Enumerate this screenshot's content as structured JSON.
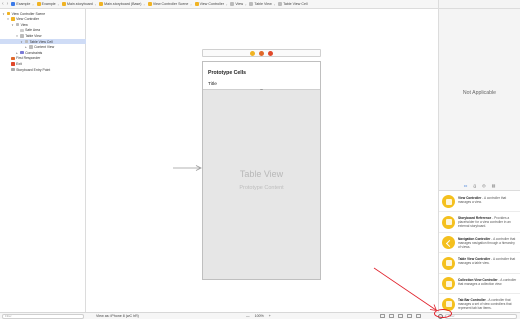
{
  "jumpbar": {
    "crumbs": [
      {
        "label": "Example",
        "color": "#3b7ae8"
      },
      {
        "label": "Example",
        "color": "#f0b323"
      },
      {
        "label": "Main.storyboard",
        "color": "#f0b323"
      },
      {
        "label": "Main.storyboard (Base)",
        "color": "#f0b323"
      },
      {
        "label": "View Controller Scene",
        "color": "#f0b323"
      },
      {
        "label": "View Controller",
        "color": "#f0b323"
      },
      {
        "label": "View",
        "color": "#bbbbbb"
      },
      {
        "label": "Table View",
        "color": "#bbbbbb"
      },
      {
        "label": "Table View Cell",
        "color": "#bbbbbb"
      }
    ]
  },
  "outline": {
    "rows": [
      {
        "label": "View Controller Scene",
        "indent": 0,
        "tri": "▾",
        "color": "#f0b323"
      },
      {
        "label": "View Controller",
        "indent": 1,
        "tri": "▾",
        "color": "#f0b323"
      },
      {
        "label": "View",
        "indent": 2,
        "tri": "▾",
        "color": "#bbbbbb"
      },
      {
        "label": "Safe Area",
        "indent": 3,
        "tri": "",
        "color": "#cccccc"
      },
      {
        "label": "Table View",
        "indent": 3,
        "tri": "▾",
        "color": "#bbbbbb"
      },
      {
        "label": "Table View Cell",
        "indent": 4,
        "tri": "▾",
        "color": "#bbbbbb",
        "selected": true
      },
      {
        "label": "Content View",
        "indent": 5,
        "tri": "▸",
        "color": "#bbbbbb"
      },
      {
        "label": "Constraints",
        "indent": 3,
        "tri": "▸",
        "color": "#7a7ad6"
      },
      {
        "label": "First Responder",
        "indent": 1,
        "tri": "",
        "color": "#e0682a"
      },
      {
        "label": "Exit",
        "indent": 1,
        "tri": "",
        "color": "#e0482a"
      },
      {
        "label": "Storyboard Entry Point",
        "indent": 1,
        "tri": "",
        "color": "#aaaaaa"
      }
    ]
  },
  "canvas": {
    "prototype_cells": "Prototype Cells",
    "cell_title": "Title",
    "table_view_label": "Table View",
    "prototype_content": "Prototype Content",
    "dock_icons": [
      {
        "name": "view-controller-dock-icon",
        "color": "#f0b323"
      },
      {
        "name": "first-responder-dock-icon",
        "color": "#e0682a"
      },
      {
        "name": "exit-dock-icon",
        "color": "#e0482a"
      }
    ]
  },
  "bottombar": {
    "filter_placeholder": "Filter",
    "view_as": "View as: iPhone 8 (wC hR)",
    "zoom_out": "—",
    "zoom_level": "100%",
    "zoom_in": "+"
  },
  "inspector": {
    "not_applicable": "Not Applicable"
  },
  "library": {
    "tabs": [
      "▭",
      "{}",
      "◎",
      "▤"
    ],
    "items": [
      {
        "title": "View Controller",
        "desc": " - A controller that manages a view.",
        "icon": "view-controller-icon"
      },
      {
        "title": "Storyboard Reference",
        "desc": " - Provides a placeholder for a view controller in an external storyboard.",
        "icon": "storyboard-reference-icon"
      },
      {
        "title": "Navigation Controller",
        "desc": " - A controller that manages navigation through a hierarchy of views.",
        "icon": "navigation-controller-icon"
      },
      {
        "title": "Table View Controller",
        "desc": " - A controller that manages a table view.",
        "icon": "table-view-controller-icon"
      },
      {
        "title": "Collection View Controller",
        "desc": " - A controller that manages a collection view.",
        "icon": "collection-view-controller-icon"
      },
      {
        "title": "Tab Bar Controller",
        "desc": " - A controller that manages a set of view controllers that represent tab bar items.",
        "icon": "tab-bar-controller-icon"
      }
    ]
  },
  "colors": {
    "annotation_red": "#e0202a",
    "selection": "#cfdcf6",
    "library_icon": "#f4c01e"
  }
}
